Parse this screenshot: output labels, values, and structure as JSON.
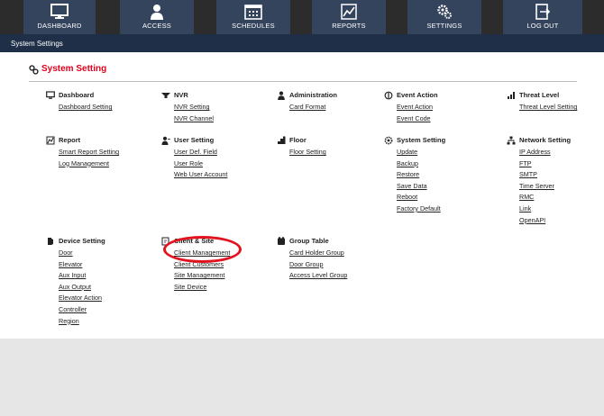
{
  "nav": [
    {
      "label": "DASHBOARD",
      "icon": "monitor-icon"
    },
    {
      "label": "ACCESS",
      "icon": "person-icon"
    },
    {
      "label": "SCHEDULES",
      "icon": "calendar-icon"
    },
    {
      "label": "REPORTS",
      "icon": "chart-icon"
    },
    {
      "label": "SETTINGS",
      "icon": "gears-icon"
    },
    {
      "label": "LOG OUT",
      "icon": "logout-icon"
    }
  ],
  "subbar": {
    "title": "System Settings"
  },
  "page": {
    "title": "System Setting"
  },
  "colors": {
    "nav_bg": "#33445c",
    "subbar_bg": "#1e2f47",
    "title_red": "#e2001a",
    "highlight_oval": "#e2131f"
  },
  "sections": [
    {
      "title": "Dashboard",
      "icon": "monitor-icon",
      "links": [
        "Dashboard Setting"
      ]
    },
    {
      "title": "NVR",
      "icon": "camera-icon",
      "links": [
        "NVR Setting",
        "NVR Channel"
      ]
    },
    {
      "title": "Administration",
      "icon": "person-icon",
      "links": [
        "Card Format"
      ]
    },
    {
      "title": "Event Action",
      "icon": "event-icon",
      "links": [
        "Event Action",
        "Event Code"
      ]
    },
    {
      "title": "Threat Level",
      "icon": "signal-icon",
      "links": [
        "Threat Level Setting"
      ]
    },
    {
      "title": "Report",
      "icon": "report-icon",
      "links": [
        "Smart Report Setting",
        "Log Management"
      ]
    },
    {
      "title": "User Setting",
      "icon": "user-icon",
      "links": [
        "User Def. Field",
        "User Role",
        "Web User Account"
      ]
    },
    {
      "title": "Floor",
      "icon": "floor-icon",
      "links": [
        "Floor Setting"
      ]
    },
    {
      "title": "System Setting",
      "icon": "gear-icon",
      "links": [
        "Update",
        "Backup",
        "Restore",
        "Save Data",
        "Reboot",
        "Factory Default"
      ]
    },
    {
      "title": "Network Setting",
      "icon": "network-icon",
      "links": [
        "IP Address",
        "FTP",
        "SMTP",
        "Time Server",
        "RMC",
        "Link",
        "OpenAPI"
      ]
    },
    {
      "title": "Device Setting",
      "icon": "device-icon",
      "links": [
        "Door",
        "Elevator",
        "Aux Input",
        "Aux Output",
        "Elevator Action",
        "Controller",
        "Region"
      ]
    },
    {
      "title": "Client & Site",
      "icon": "client-icon",
      "links": [
        "Client Management",
        "Client Customers",
        "Site Management",
        "Site Device"
      ]
    },
    {
      "title": "Group Table",
      "icon": "group-icon",
      "links": [
        "Card Holder Group",
        "Door Group",
        "Access Level Group"
      ]
    }
  ]
}
